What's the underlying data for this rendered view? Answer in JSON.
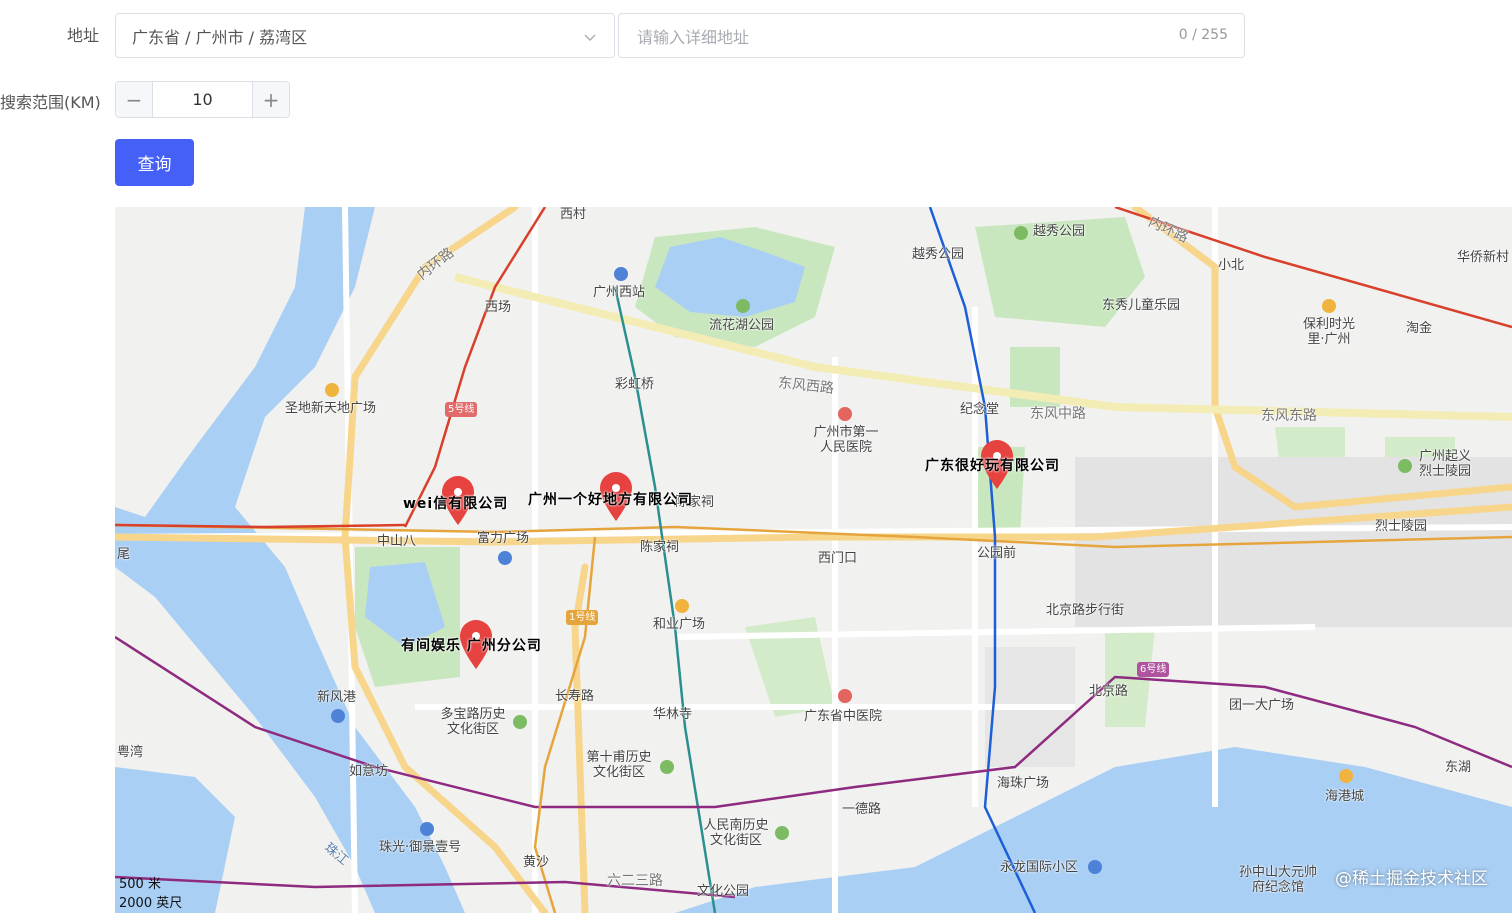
{
  "form": {
    "address_label": "地址",
    "region_value": "广东省 / 广州市 / 荔湾区",
    "detail_placeholder": "请输入详细地址",
    "detail_value": "",
    "detail_counter": "0 / 255",
    "range_label": "搜索范围(KM)",
    "range_value": "10",
    "minus": "−",
    "plus": "+",
    "query_button": "查询"
  },
  "map": {
    "markers": [
      {
        "label": "wei信有限公司"
      },
      {
        "label": "广州一个好地方有限公司"
      },
      {
        "label": "广东很好玩有限公司"
      },
      {
        "label": "有间娱乐 广州分公司"
      }
    ],
    "places": {
      "xicun": "西村",
      "yuexiu_park_station": "越秀公园",
      "yuexiu_park": "越秀公园",
      "xiaobei": "小北",
      "huaqiao": "华侨新村",
      "neihuan_top": "内环路",
      "neihuan_left": "内环路",
      "xichang": "西场",
      "guangzhou_west": "广州西站",
      "liuhua": "流花湖公园",
      "dongxiu": "东秀儿童乐园",
      "poly": "保利时光里·广州",
      "taojin": "淘金",
      "shengdi": "圣地新天地广场",
      "line5": "5号线",
      "caihong": "彩虹桥",
      "dongfeng_west": "东风西路",
      "hospital1": "广州市第一人民医院",
      "jiniantang": "纪念堂",
      "dongfeng_mid": "东风中路",
      "dongfeng_east": "东风东路",
      "qiyi": "广州起义烈士陵园",
      "zhongshan8": "中山八",
      "fuli": "富力广场",
      "chenjiaci_station": "陈家祠",
      "chenjiaci_top": "陈家祠",
      "ximenkou": "西门口",
      "gongyuanqian": "公园前",
      "lieshi": "烈士陵园",
      "line1": "1号线",
      "heye": "和业广场",
      "beijing_walk": "北京路步行街",
      "xinfenggang": "新风港",
      "changshou": "长寿路",
      "duobao": "多宝路历史文化街区",
      "hualin": "华林寺",
      "tcm_hospital": "广东省中医院",
      "beijinglu": "北京路",
      "line6": "6号线",
      "tuanyi": "团一大广场",
      "yuewan": "粤湾",
      "ruyifang": "如意坊",
      "shishifu": "第十甫历史文化街区",
      "yidelu": "一德路",
      "haizhu": "海珠广场",
      "haigang": "海港城",
      "donghu": "东湖",
      "renmin_south": "人民南历史文化街区",
      "zhujiang": "珠江",
      "zhuguang": "珠光·御景壹号",
      "huangsha": "黄沙",
      "liuersan": "六二三路",
      "wenhua": "文化公园",
      "yonglong": "永龙国际小区",
      "sunyat": "孙中山大元帅府纪念馆",
      "wei_label": "尾"
    },
    "scale_metric": "500 米",
    "scale_imperial": "2000 英尺",
    "watermark": "@稀土掘金技术社区"
  }
}
